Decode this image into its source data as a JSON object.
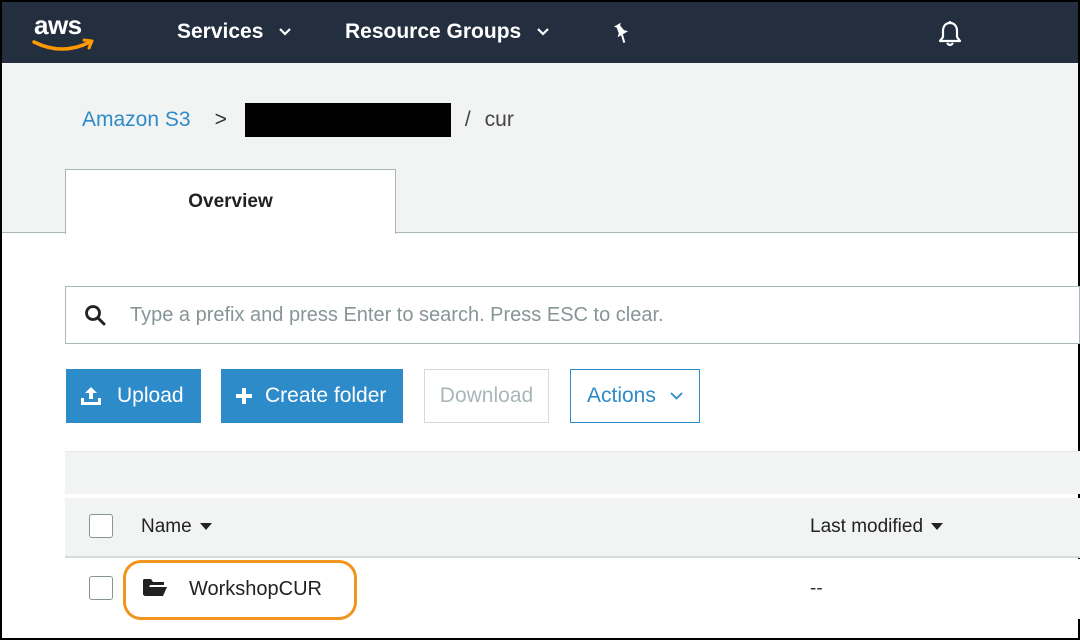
{
  "topnav": {
    "logo_text": "aws",
    "services_label": "Services",
    "resource_groups_label": "Resource Groups"
  },
  "breadcrumb": {
    "root": "Amazon S3",
    "separator": ">",
    "slash": "/",
    "current": "cur"
  },
  "tabs": [
    {
      "label": "Overview"
    }
  ],
  "search": {
    "placeholder": "Type a prefix and press Enter to search. Press ESC to clear.",
    "value": ""
  },
  "toolbar": {
    "upload_label": "Upload",
    "create_folder_label": "Create folder",
    "download_label": "Download",
    "actions_label": "Actions"
  },
  "table": {
    "columns": [
      "Name",
      "Last modified"
    ],
    "rows": [
      {
        "name": "WorkshopCUR",
        "last_modified": "--"
      }
    ]
  },
  "colors": {
    "nav_bg": "#232f3e",
    "accent": "#2e8bc9",
    "highlight": "#f0961e"
  }
}
